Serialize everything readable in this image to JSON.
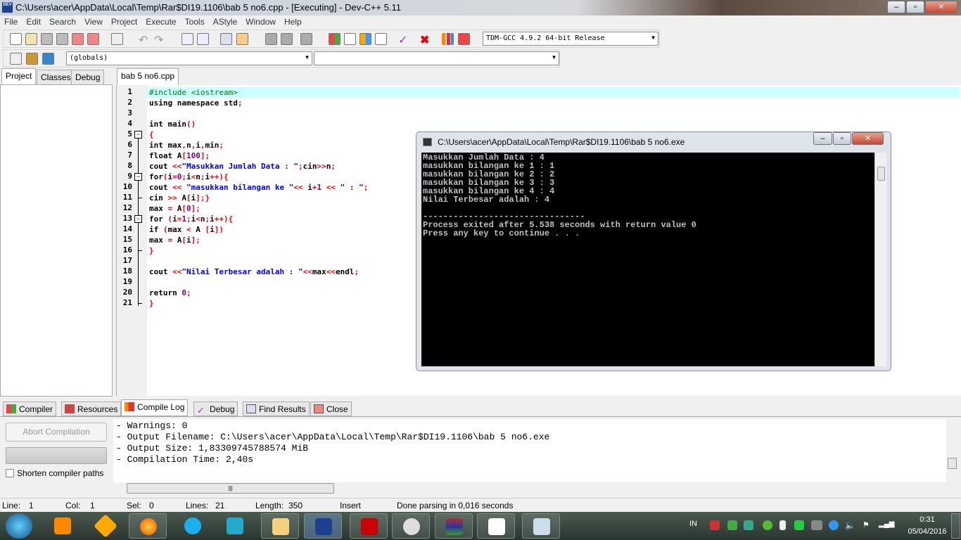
{
  "window": {
    "title": "C:\\Users\\acer\\AppData\\Local\\Temp\\Rar$DI19.1106\\bab 5 no6.cpp - [Executing] - Dev-C++ 5.11",
    "app_icon": "DEV"
  },
  "menu": [
    "File",
    "Edit",
    "Search",
    "View",
    "Project",
    "Execute",
    "Tools",
    "AStyle",
    "Window",
    "Help"
  ],
  "toolbar": {
    "compiler_select": "TDM-GCC 4.9.2 64-bit Release",
    "scope_select": "(globals)",
    "member_select": ""
  },
  "left_tabs": [
    "Project",
    "Classes",
    "Debug"
  ],
  "editor": {
    "tab": "bab 5 no6.cpp",
    "lines": [
      [
        [
          "#include <iostream>",
          "c"
        ]
      ],
      [
        [
          "using namespace std",
          "k"
        ],
        [
          ";",
          "p"
        ]
      ],
      [],
      [
        [
          "int main",
          "k"
        ],
        [
          "()",
          "p"
        ]
      ],
      [
        [
          "{",
          "p"
        ]
      ],
      [
        [
          "int max",
          "k"
        ],
        [
          ",",
          "p"
        ],
        [
          "n",
          "k"
        ],
        [
          ",",
          "p"
        ],
        [
          "i",
          "k"
        ],
        [
          ",",
          "p"
        ],
        [
          "min",
          "k"
        ],
        [
          ";",
          "p"
        ]
      ],
      [
        [
          "float A",
          "k"
        ],
        [
          "[",
          "p"
        ],
        [
          "100",
          "n"
        ],
        [
          "];",
          "p"
        ]
      ],
      [
        [
          "cout ",
          "k"
        ],
        [
          "<<",
          "p"
        ],
        [
          "\"Masukkan Jumlah Data : \"",
          "s"
        ],
        [
          ";",
          "p"
        ],
        [
          "cin",
          "k"
        ],
        [
          ">>",
          "p"
        ],
        [
          "n",
          "k"
        ],
        [
          ";",
          "p"
        ]
      ],
      [
        [
          "for",
          "k"
        ],
        [
          "(",
          "p"
        ],
        [
          "i",
          "k"
        ],
        [
          "=",
          "p"
        ],
        [
          "0",
          "n"
        ],
        [
          ";",
          "p"
        ],
        [
          "i",
          "k"
        ],
        [
          "<",
          "p"
        ],
        [
          "n",
          "k"
        ],
        [
          ";",
          "p"
        ],
        [
          "i",
          "k"
        ],
        [
          "++){",
          "p"
        ]
      ],
      [
        [
          "cout ",
          "k"
        ],
        [
          "<<",
          "p"
        ],
        [
          " \"masukkan bilangan ke \"",
          "s"
        ],
        [
          "<<",
          "p"
        ],
        [
          " i",
          "k"
        ],
        [
          "+",
          "p"
        ],
        [
          "1",
          "n"
        ],
        [
          " << ",
          "p"
        ],
        [
          "\" : \"",
          "s"
        ],
        [
          ";",
          "p"
        ]
      ],
      [
        [
          "cin ",
          "k"
        ],
        [
          ">>",
          "p"
        ],
        [
          " A",
          "k"
        ],
        [
          "[",
          "p"
        ],
        [
          "i",
          "k"
        ],
        [
          "];}",
          "p"
        ]
      ],
      [
        [
          "max ",
          "k"
        ],
        [
          "=",
          "p"
        ],
        [
          " A",
          "k"
        ],
        [
          "[",
          "p"
        ],
        [
          "0",
          "n"
        ],
        [
          "];",
          "p"
        ]
      ],
      [
        [
          "for ",
          "k"
        ],
        [
          "(",
          "p"
        ],
        [
          "i",
          "k"
        ],
        [
          "=",
          "p"
        ],
        [
          "1",
          "n"
        ],
        [
          ";",
          "p"
        ],
        [
          "i",
          "k"
        ],
        [
          "<",
          "p"
        ],
        [
          "n",
          "k"
        ],
        [
          ";",
          "p"
        ],
        [
          "i",
          "k"
        ],
        [
          "++){",
          "p"
        ]
      ],
      [
        [
          "if ",
          "k"
        ],
        [
          "(",
          "p"
        ],
        [
          "max ",
          "k"
        ],
        [
          "<",
          "p"
        ],
        [
          " A ",
          "k"
        ],
        [
          "[",
          "p"
        ],
        [
          "i",
          "k"
        ],
        [
          "])",
          "p"
        ]
      ],
      [
        [
          "max ",
          "k"
        ],
        [
          "=",
          "p"
        ],
        [
          " A",
          "k"
        ],
        [
          "[",
          "p"
        ],
        [
          "i",
          "k"
        ],
        [
          "];",
          "p"
        ]
      ],
      [
        [
          "}",
          "p"
        ]
      ],
      [],
      [
        [
          "cout ",
          "k"
        ],
        [
          "<<",
          "p"
        ],
        [
          "\"Nilai Terbesar adalah : \"",
          "s"
        ],
        [
          "<<",
          "p"
        ],
        [
          "max",
          "k"
        ],
        [
          "<<",
          "p"
        ],
        [
          "endl",
          "k"
        ],
        [
          ";",
          "p"
        ]
      ],
      [],
      [
        [
          "return ",
          "k"
        ],
        [
          "0",
          "n"
        ],
        [
          ";",
          "p"
        ]
      ],
      [
        [
          "}",
          "p"
        ]
      ]
    ]
  },
  "console": {
    "title": "C:\\Users\\acer\\AppData\\Local\\Temp\\Rar$DI19.1106\\bab 5 no6.exe",
    "output": "Masukkan Jumlah Data : 4\nmasukkan bilangan ke 1 : 1\nmasukkan bilangan ke 2 : 2\nmasukkan bilangan ke 3 : 3\nmasukkan bilangan ke 4 : 4\nNilai Terbesar adalah : 4\n\n--------------------------------\nProcess exited after 5.538 seconds with return value 0\nPress any key to continue . . ."
  },
  "bottom_tabs": [
    "Compiler",
    "Resources",
    "Compile Log",
    "Debug",
    "Find Results",
    "Close"
  ],
  "compile": {
    "abort_label": "Abort Compilation",
    "shorten_label": "Shorten compiler paths",
    "log": "- Warnings: 0\n- Output Filename: C:\\Users\\acer\\AppData\\Local\\Temp\\Rar$DI19.1106\\bab 5 no6.exe\n- Output Size: 1,83309745788574 MiB\n- Compilation Time: 2,40s"
  },
  "status": {
    "line_label": "Line:",
    "line": "1",
    "col_label": "Col:",
    "col": "1",
    "sel_label": "Sel:",
    "sel": "0",
    "lines_label": "Lines:",
    "lines": "21",
    "length_label": "Length:",
    "length": "350",
    "mode": "Insert",
    "message": "Done parsing in 0,016 seconds"
  },
  "taskbar": {
    "apps": [
      "start",
      "windows-media-player",
      "winamp",
      "firefox",
      "skype",
      "picsart",
      "explorer",
      "dev-cpp",
      "acrobat",
      "paint",
      "winrar",
      "dinosaur-app",
      "window-app"
    ],
    "lang": "IN",
    "time": "0:31",
    "date": "05/04/2016"
  }
}
